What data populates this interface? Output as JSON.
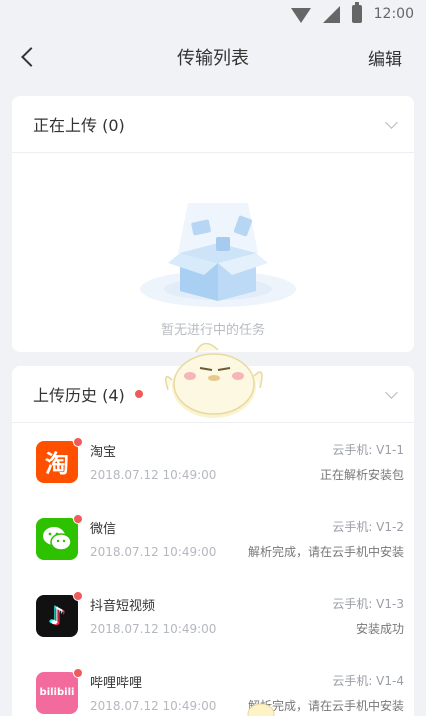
{
  "statusbar": {
    "time": "12:00"
  },
  "navbar": {
    "title": "传输列表",
    "edit_label": "编辑"
  },
  "uploading": {
    "title": "正在上传 (0)",
    "empty_text": "暂无进行中的任务"
  },
  "history": {
    "title": "上传历史 (4)",
    "items": [
      {
        "name": "淘宝",
        "time": "2018.07.12  10:49:00",
        "device": "云手机: V1-1",
        "status": "正在解析安装包",
        "icon": "taobao-icon",
        "glyph": "淘",
        "color": "#ff5000"
      },
      {
        "name": "微信",
        "time": "2018.07.12  10:49:00",
        "device": "云手机: V1-2",
        "status": "解析完成，请在云手机中安装",
        "icon": "wechat-icon",
        "glyph": "",
        "color": "#2dc100"
      },
      {
        "name": "抖音短视频",
        "time": "2018.07.12  10:49:00",
        "device": "云手机: V1-3",
        "status": "安装成功",
        "icon": "tiktok-icon",
        "glyph": "♪",
        "color": "#111111"
      },
      {
        "name": "哔哩哔哩",
        "time": "2018.07.12  10:49:00",
        "device": "云手机: V1-4",
        "status": "解析完成，请在云手机中安装",
        "icon": "bilibili-icon",
        "glyph": "bilibili",
        "color": "#f26b9c"
      }
    ]
  }
}
